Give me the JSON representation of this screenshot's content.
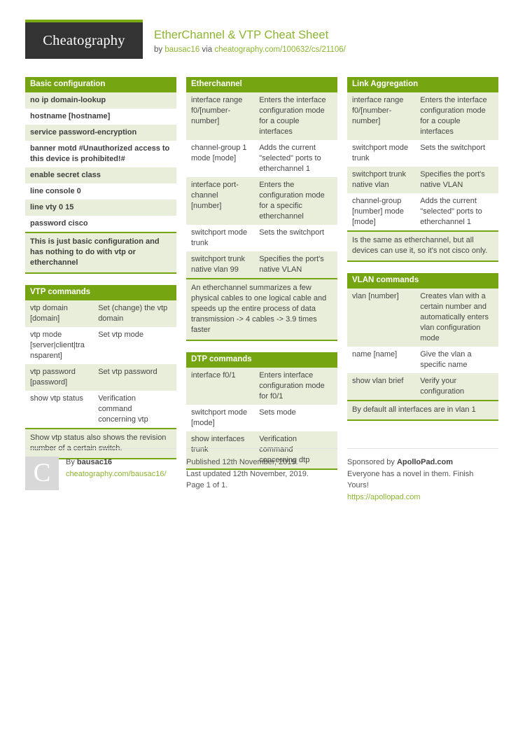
{
  "header": {
    "logo": "Cheatography",
    "title": "EtherChannel & VTP Cheat Sheet",
    "by_prefix": "by ",
    "author": "bausac16",
    "via": " via ",
    "source_url": "cheatography.com/100632/cs/21106/"
  },
  "colors": {
    "accent_green": "#76a512",
    "title_green": "#8cb531",
    "row_tint": "#e8eeda",
    "logo_bg": "#333333"
  },
  "columns": [
    {
      "blocks": [
        {
          "title": "Basic configuration",
          "type": "one",
          "rows": [
            [
              "no ip domain-lookup"
            ],
            [
              "hostname [hostname]"
            ],
            [
              "service password-encryption"
            ],
            [
              "banner motd #Unauthorized access to this device is prohibited!#"
            ],
            [
              "enable secret class"
            ],
            [
              "line console 0"
            ],
            [
              "line vty 0 15"
            ],
            [
              "password cisco"
            ]
          ],
          "note": "This is just basic configuration and has nothing to do with vtp or etherchannel",
          "note_bold": true
        },
        {
          "title": "VTP commands",
          "type": "two",
          "rows": [
            [
              "vtp domain [domain]",
              "Set (change) the vtp domain"
            ],
            [
              "vtp mode [server|client|transparent]",
              "Set vtp mode"
            ],
            [
              "vtp password [password]",
              "Set vtp password"
            ],
            [
              "show vtp status",
              "Verification command concerning vtp"
            ]
          ],
          "note": "Show vtp status also shows the revision number of a certain switch.",
          "note_bold": false
        }
      ]
    },
    {
      "blocks": [
        {
          "title": "Etherchannel",
          "type": "two",
          "rows": [
            [
              "interface range f0/[number-number]",
              "Enters the interface configuration mode for a couple interfaces"
            ],
            [
              "channel-group 1 mode [mode]",
              "Adds the current \"selected\" ports to etherchannel 1"
            ],
            [
              "interface port-channel [number]",
              "Enters the configuration mode for a specific etherchannel"
            ],
            [
              "switchport mode trunk",
              "Sets the switchport"
            ],
            [
              "switchport trunk native vlan 99",
              "Specifies the port's native VLAN"
            ]
          ],
          "note": "An etherchannel summarizes a few physical cables to one logical cable and speeds up the entire process of data transmission -> 4 cables -> 3.9 times faster",
          "note_bold": false
        },
        {
          "title": "DTP commands",
          "type": "two",
          "rows": [
            [
              "interface f0/1",
              "Enters interface configuration mode for f0/1"
            ],
            [
              "switchport mode [mode]",
              "Sets mode"
            ],
            [
              "show interfaces trunk",
              "Verification command concerning dtp"
            ]
          ],
          "note": null,
          "note_bold": false
        }
      ]
    },
    {
      "blocks": [
        {
          "title": "Link Aggregation",
          "type": "two",
          "rows": [
            [
              "interface range f0/[number-number]",
              "Enters the interface configuration mode for a couple interfaces"
            ],
            [
              "switchport mode trunk",
              "Sets the switchport"
            ],
            [
              "switchport trunk native vlan",
              "Specifies the port's native VLAN"
            ],
            [
              "channel-group [number] mode [mode]",
              "Adds the current \"selected\" ports to etherchannel 1"
            ]
          ],
          "note": "Is the same as etherchannel, but all devices can use it, so it's not cisco only.",
          "note_bold": false
        },
        {
          "title": "VLAN commands",
          "type": "two",
          "rows": [
            [
              "vlan [number]",
              "Creates vlan with a certain number and automatically enters vlan configuration mode"
            ],
            [
              "name [name]",
              "Give the vlan a specific name"
            ],
            [
              "show vlan brief",
              "Verify your configuration"
            ]
          ],
          "note": "By default all interfaces are in vlan 1",
          "note_bold": false
        }
      ]
    }
  ],
  "footer": {
    "author_initial": "C",
    "by_label": "By ",
    "author": "bausac16",
    "author_url": "cheatography.com/bausac16/",
    "published": "Published 12th November, 2019.",
    "updated": "Last updated 12th November, 2019.",
    "page": "Page 1 of 1.",
    "sponsor_label": "Sponsored by ",
    "sponsor_name": "ApolloPad.com",
    "sponsor_line1": "Everyone has a novel in them. Finish",
    "sponsor_line2": "Yours!",
    "sponsor_url": "https://apollopad.com"
  }
}
